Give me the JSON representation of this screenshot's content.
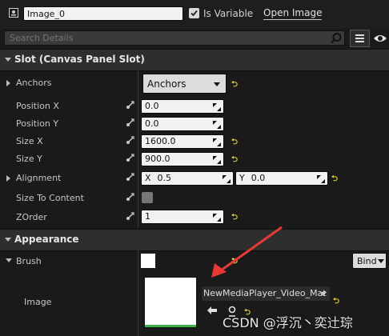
{
  "top": {
    "name_value": "Image_0",
    "is_variable_label": "Is Variable",
    "is_variable_checked": true,
    "open_image_label": "Open Image",
    "search_placeholder": "Search Details"
  },
  "slot_section": {
    "title": "Slot (Canvas Panel Slot)",
    "anchors": {
      "label": "Anchors",
      "value": "Anchors"
    },
    "position_x": {
      "label": "Position X",
      "value": "0.0"
    },
    "position_y": {
      "label": "Position Y",
      "value": "0.0"
    },
    "size_x": {
      "label": "Size X",
      "value": "1600.0"
    },
    "size_y": {
      "label": "Size Y",
      "value": "900.0"
    },
    "alignment": {
      "label": "Alignment",
      "x_label": "X",
      "x_value": "0.5",
      "y_label": "Y",
      "y_value": "0.0"
    },
    "size_to_content": {
      "label": "Size To Content",
      "checked": false
    },
    "zorder": {
      "label": "ZOrder",
      "value": "1"
    }
  },
  "appearance_section": {
    "title": "Appearance",
    "brush": {
      "label": "Brush",
      "bind_label": "Bind"
    },
    "image": {
      "label": "Image",
      "asset_name": "NewMediaPlayer_Video_Mat"
    }
  },
  "watermark": "CSDN @浮沉丶奕辻琮",
  "colors": {
    "background": "#1a1a1a",
    "header": "#2e2e2e",
    "accent_yellow": "#e8d33b",
    "annotation_arrow": "#e53935"
  }
}
